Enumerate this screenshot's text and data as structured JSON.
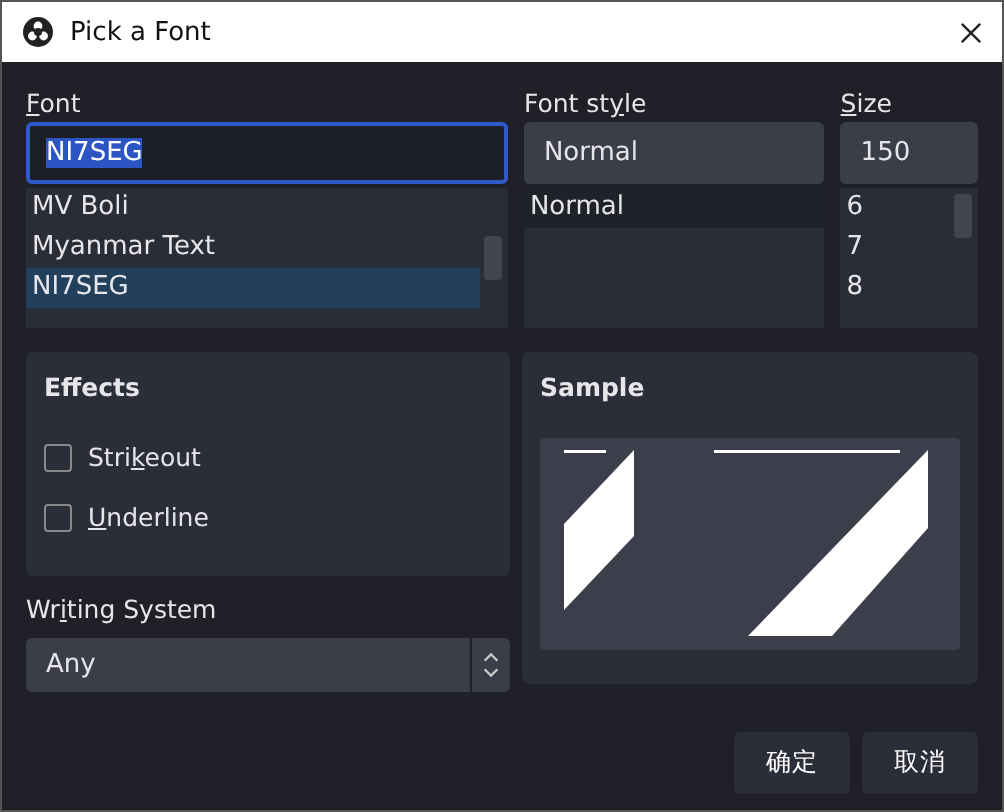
{
  "window": {
    "title": "Pick a Font"
  },
  "font": {
    "label": "Font",
    "value": "NI7SEG",
    "items": [
      {
        "label": "MV Boli",
        "selected": false
      },
      {
        "label": "Myanmar Text",
        "selected": false
      },
      {
        "label": "NI7SEG",
        "selected": true
      }
    ]
  },
  "font_style": {
    "label": "Font style",
    "value": "Normal",
    "items": [
      {
        "label": "Normal",
        "selected": true
      }
    ]
  },
  "size": {
    "label": "Size",
    "value": "150",
    "items": [
      {
        "label": "6",
        "selected": false
      },
      {
        "label": "7",
        "selected": false
      },
      {
        "label": "8",
        "selected": false
      }
    ]
  },
  "effects": {
    "title": "Effects",
    "options": [
      {
        "label": "Strikeout",
        "checked": false
      },
      {
        "label": "Underline",
        "checked": false
      }
    ]
  },
  "writing_system": {
    "label": "Writing System",
    "value": "Any"
  },
  "sample": {
    "title": "Sample"
  },
  "buttons": [
    "确定",
    "取消"
  ]
}
